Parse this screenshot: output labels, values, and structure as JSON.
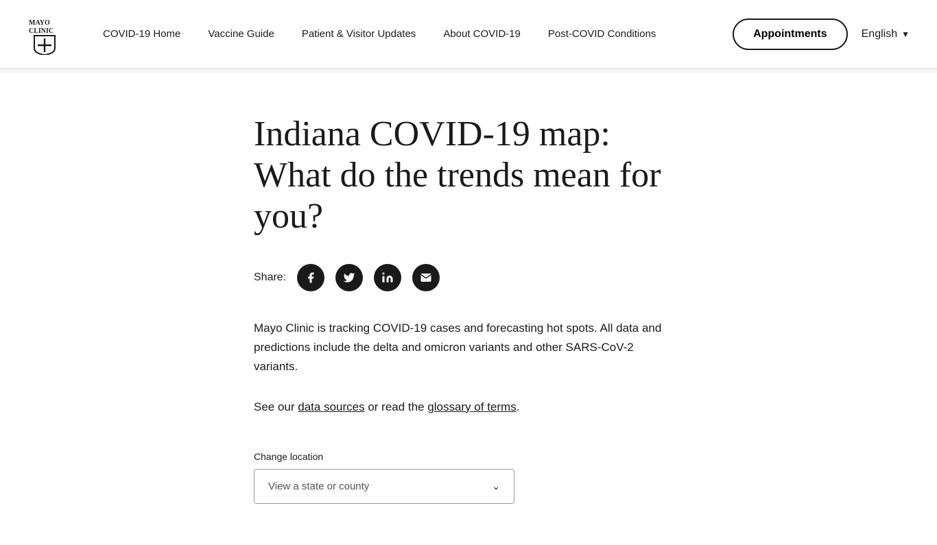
{
  "header": {
    "logo_alt": "Mayo Clinic",
    "nav": {
      "items": [
        {
          "label": "COVID-19 Home",
          "id": "covid19-home"
        },
        {
          "label": "Vaccine Guide",
          "id": "vaccine-guide"
        },
        {
          "label": "Patient & Visitor Updates",
          "id": "patient-visitor"
        },
        {
          "label": "About COVID-19",
          "id": "about-covid"
        },
        {
          "label": "Post-COVID Conditions",
          "id": "post-covid"
        }
      ]
    },
    "appointments_label": "Appointments",
    "language_label": "English"
  },
  "main": {
    "title_line1": "Indiana COVID-19 map:",
    "title_line2": "What do the trends mean for",
    "title_line3": "you?",
    "share_label": "Share:",
    "social_icons": [
      {
        "name": "facebook",
        "symbol": "f"
      },
      {
        "name": "twitter",
        "symbol": "𝕏"
      },
      {
        "name": "linkedin",
        "symbol": "in"
      },
      {
        "name": "email",
        "symbol": "✉"
      }
    ],
    "description": "Mayo Clinic is tracking COVID-19 cases and forecasting hot spots. All data and predictions include the delta and omicron variants and other SARS-CoV-2 variants.",
    "see_our_prefix": "See our ",
    "data_sources_label": "data sources",
    "see_our_middle": " or read the ",
    "glossary_label": "glossary of terms",
    "see_our_suffix": ".",
    "change_location_label": "Change location",
    "dropdown_placeholder": "View a state or county"
  }
}
